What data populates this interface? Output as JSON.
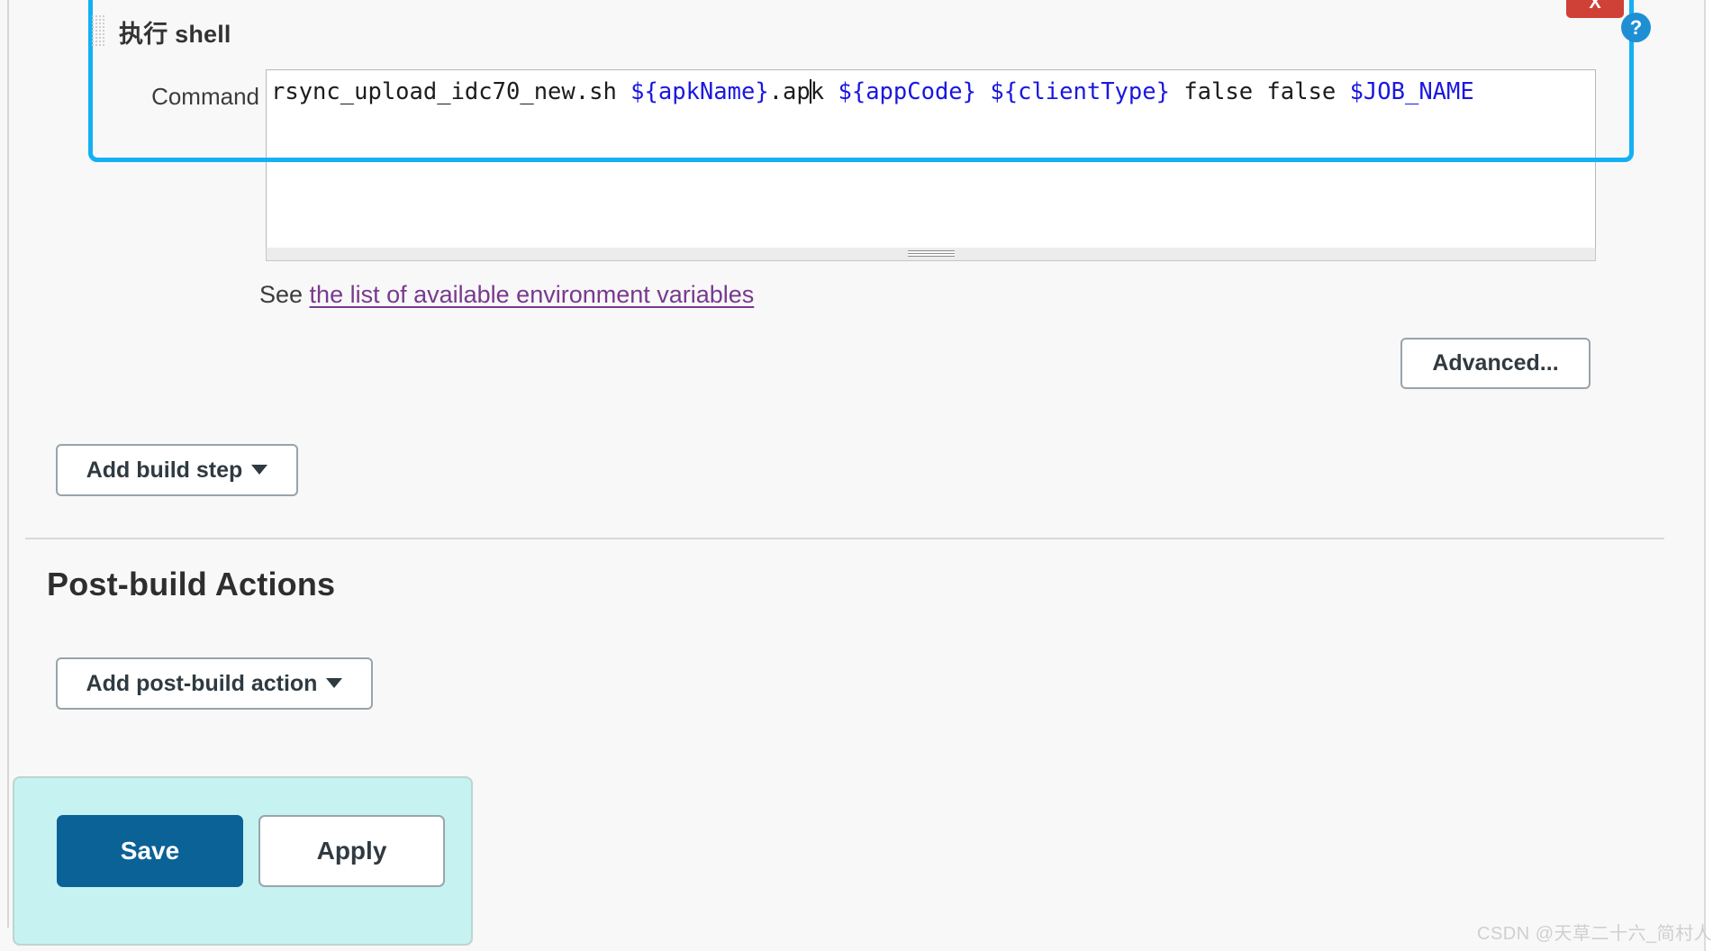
{
  "build_step": {
    "title": "执行 shell",
    "delete_label": "X",
    "help_label": "?",
    "drag_handle_name": "drag-handle",
    "command": {
      "label": "Command",
      "tokens": [
        {
          "text": "rsync_upload_idc70_new.sh ",
          "type": "plain"
        },
        {
          "text": "${apkName}",
          "type": "var"
        },
        {
          "text": ".ap",
          "type": "plain"
        },
        {
          "text": "",
          "type": "caret"
        },
        {
          "text": "k ",
          "type": "plain"
        },
        {
          "text": "${appCode}",
          "type": "var"
        },
        {
          "text": " ",
          "type": "plain"
        },
        {
          "text": "${clientType}",
          "type": "var"
        },
        {
          "text": " false false ",
          "type": "plain"
        },
        {
          "text": "$JOB_NAME",
          "type": "var"
        }
      ],
      "value": "rsync_upload_idc70_new.sh ${apkName}.apk ${appCode} ${clientType} false false $JOB_NAME"
    },
    "see_prefix": "See ",
    "see_link_text": "the list of available environment variables",
    "advanced_label": "Advanced..."
  },
  "actions": {
    "add_build_step_label": "Add build step",
    "add_post_build_label": "Add post-build action"
  },
  "post_build": {
    "heading": "Post-build Actions"
  },
  "submit": {
    "save_label": "Save",
    "apply_label": "Apply"
  },
  "watermark": {
    "text": "CSDN @天草二十六_简村人"
  },
  "colors": {
    "focus_ring": "#13b0f5",
    "delete_button": "#cf4137",
    "help_icon": "#1f8fd4",
    "link": "#78398f",
    "variable_token": "#1a17e0",
    "save_button": "#0a6296",
    "submit_bar": "#c6f2f2",
    "page_background": "#f8f8f8"
  }
}
